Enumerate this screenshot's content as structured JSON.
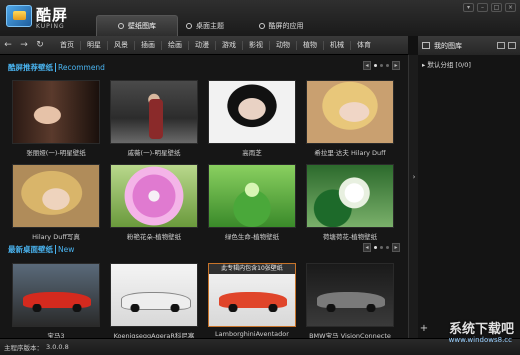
{
  "app": {
    "name": "酷屏",
    "subtitle": "KUPING"
  },
  "main_tabs": [
    {
      "label": "壁纸图库",
      "active": true
    },
    {
      "label": "桌面主题",
      "active": false
    },
    {
      "label": "酷屏的应用",
      "active": false
    }
  ],
  "nav": {
    "categories": [
      "首页",
      "明星",
      "风景",
      "插画",
      "绘画",
      "动漫",
      "游戏",
      "影视",
      "动物",
      "植物",
      "机械",
      "体育"
    ]
  },
  "sections": {
    "recommend": {
      "title_cn": "酷屏推荐壁纸",
      "title_en": "Recommend",
      "items": [
        "张丽娅(一)-明星壁纸",
        "戚薇(一)-明星壁纸",
        "高雨芝",
        "希拉里·达夫 Hilary Duff",
        "Hilary Duff写真",
        "粉艳花朵-植物壁纸",
        "绿色生命-植物壁纸",
        "荷塘荷花-植物壁纸"
      ]
    },
    "latest": {
      "title_cn": "最新桌面壁纸",
      "title_en": "New",
      "selected_banner": "此专辑内包含10张壁纸",
      "items": [
        "宝马3",
        "KoenigseggAgeraR科尼塞",
        "LamborghiniAventador",
        "BMW宝马 VisionConnecte"
      ]
    }
  },
  "right_panel": {
    "title": "我的图库",
    "group": "默认分组 [0/0]"
  },
  "status": {
    "label": "主程序版本：",
    "version": "3.0.0.8"
  },
  "watermark": {
    "text": "系统下载吧",
    "sub": "www.windows8.cc"
  },
  "colors": {
    "accent": "#4ab4f0",
    "selected_border": "#c8742a",
    "background": "#161616"
  }
}
